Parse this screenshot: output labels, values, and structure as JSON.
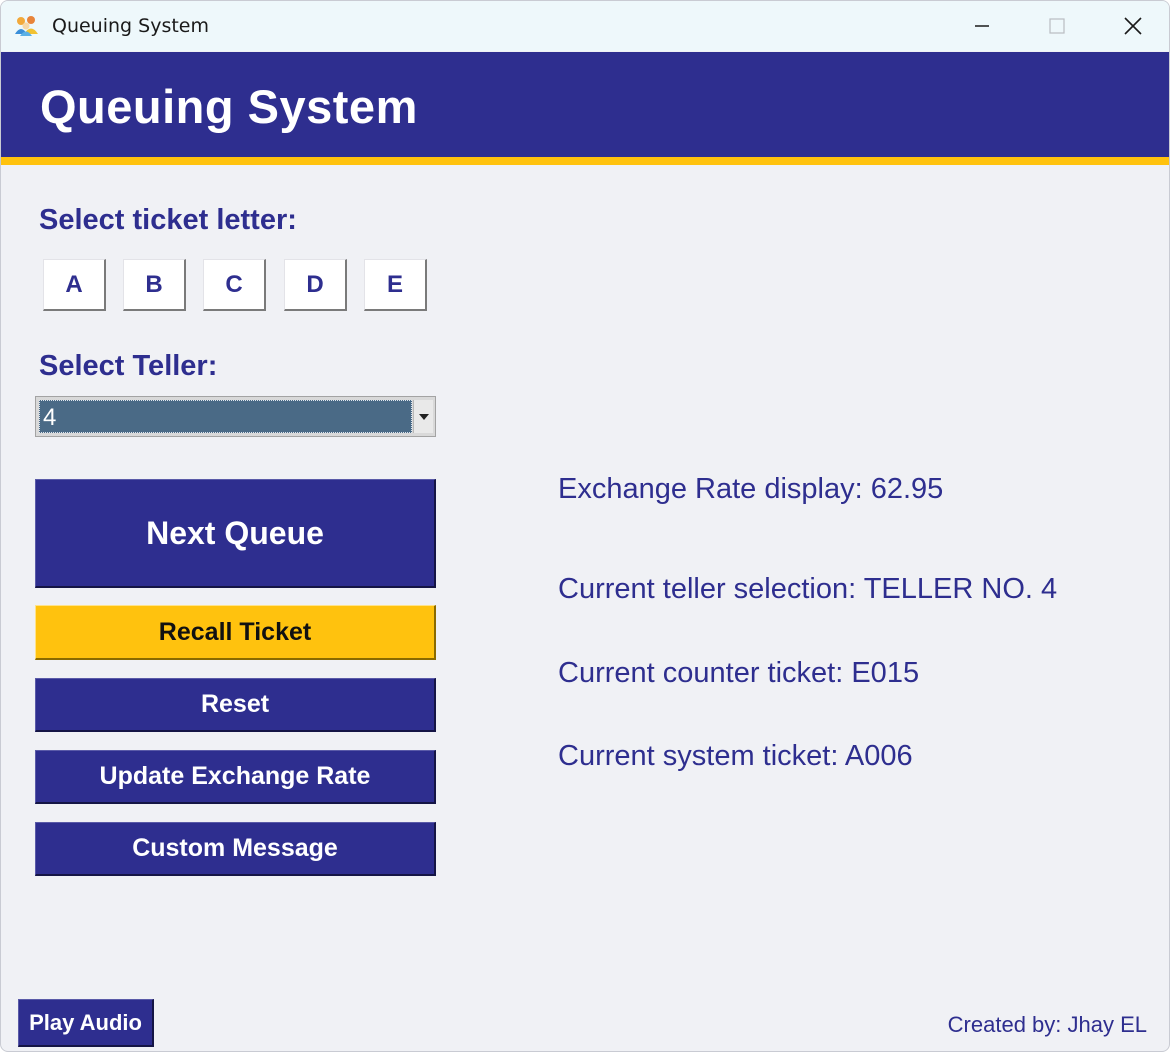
{
  "window": {
    "title": "Queuing System",
    "controls": [
      "minimize",
      "maximize",
      "close"
    ]
  },
  "header": {
    "title": "Queuing System"
  },
  "ticket_letter": {
    "label": "Select ticket letter:",
    "letters": [
      "A",
      "B",
      "C",
      "D",
      "E"
    ]
  },
  "teller": {
    "label": "Select Teller:",
    "selected": "4"
  },
  "buttons": {
    "next_queue": "Next Queue",
    "recall_ticket": "Recall Ticket",
    "reset": "Reset",
    "update_exchange_rate": "Update Exchange Rate",
    "custom_message": "Custom Message",
    "play_audio": "Play Audio"
  },
  "info": {
    "exchange_rate": "Exchange Rate display: 62.95",
    "teller_selection": "Current teller selection: TELLER NO. 4",
    "counter_ticket": "Current counter ticket: E015",
    "system_ticket": "Current system ticket: A006"
  },
  "footer": {
    "credit": "Created by: Jhay EL"
  },
  "colors": {
    "primary": "#2e2e8f",
    "accent": "#ffc20e",
    "background": "#f0f1f5",
    "select_highlight": "#4a6a86"
  },
  "icons": {
    "app": "people-group-icon",
    "dropdown": "chevron-down-icon"
  }
}
